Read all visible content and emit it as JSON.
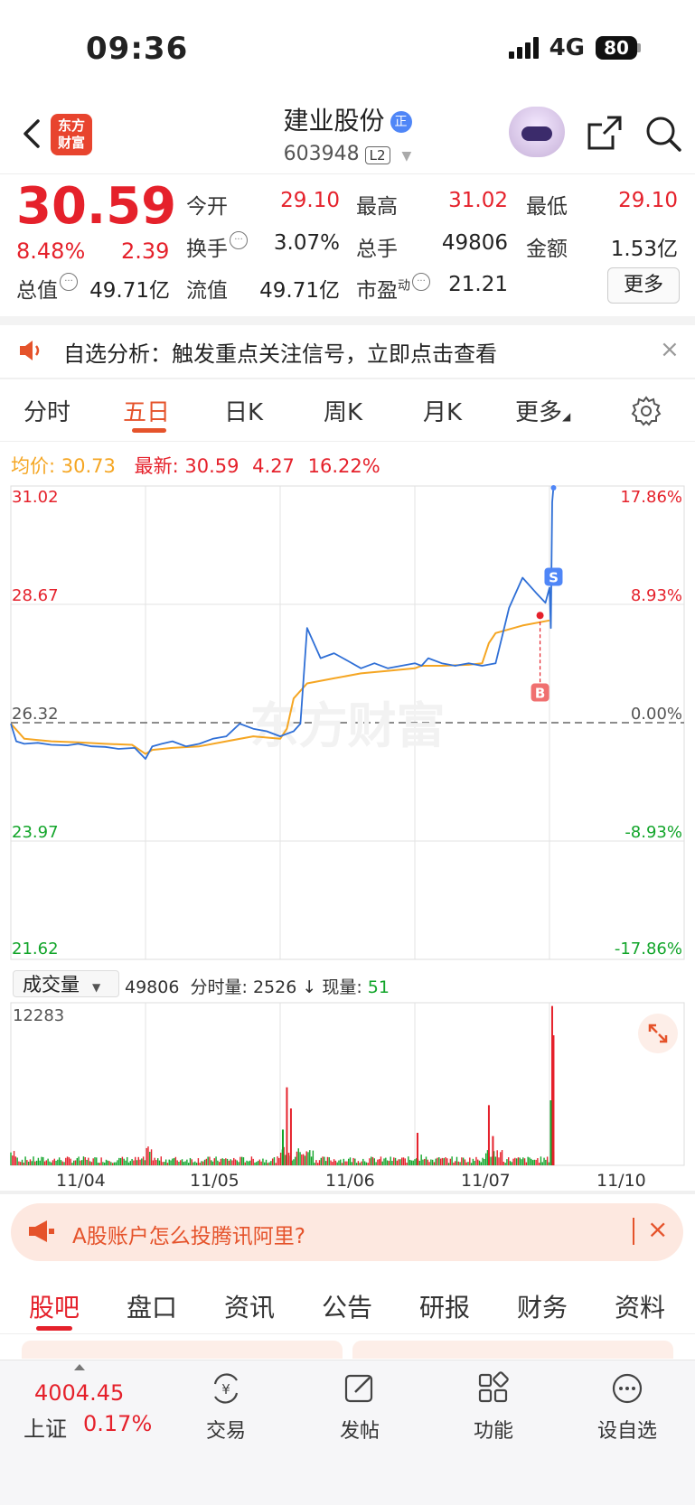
{
  "status_bar": {
    "time": "09:36",
    "network": "4G",
    "battery": "80"
  },
  "header": {
    "logo_line1": "东方",
    "logo_line2": "财富",
    "stock_name": "建业股份",
    "name_badge": "正",
    "stock_code": "603948",
    "level_badge": "L2"
  },
  "quote": {
    "price": "30.59",
    "change_pct": "8.48%",
    "change_amt": "2.39",
    "open_label": "今开",
    "open": "29.10",
    "high_label": "最高",
    "high": "31.02",
    "low_label": "最低",
    "low": "29.10",
    "turnover_label": "换手",
    "turnover": "3.07%",
    "volume_label": "总手",
    "volume": "49806",
    "amount_label": "金额",
    "amount": "1.53亿",
    "mktcap_label": "总值",
    "mktcap": "49.71亿",
    "float_label": "流值",
    "float_cap": "49.71亿",
    "pe_label": "市盈",
    "pe_sup": "动",
    "pe": "21.21",
    "more_label": "更多"
  },
  "notice": {
    "text": "自选分析：触发重点关注信号，立即点击查看",
    "close": "×"
  },
  "chart_tabs": [
    "分时",
    "五日",
    "日K",
    "周K",
    "月K",
    "更多"
  ],
  "active_tab": "五日",
  "legend": {
    "avg_label": "均价:",
    "avg_value": "30.73",
    "latest_label": "最新:",
    "latest_value": "30.59",
    "latest_change": "4.27",
    "latest_pct": "16.22%"
  },
  "chart_data": {
    "type": "line",
    "watermark": "东方财富",
    "y_left_ticks": [
      "31.02",
      "28.67",
      "26.32",
      "23.97",
      "21.62"
    ],
    "y_right_ticks": [
      "17.86%",
      "8.93%",
      "0.00%",
      "-8.93%",
      "-17.86%"
    ],
    "ylim": [
      21.62,
      31.02
    ],
    "base_price": 26.32,
    "x_labels": [
      "11/04",
      "11/05",
      "11/06",
      "11/07",
      "11/10"
    ],
    "markers": [
      {
        "label": "S",
        "color": "#4f86f7"
      },
      {
        "label": "B",
        "color": "#f07070"
      }
    ],
    "series": [
      {
        "name": "最新",
        "color": "#2f6fd6",
        "x": [
          0,
          0.04,
          0.1,
          0.2,
          0.3,
          0.42,
          0.5,
          0.6,
          0.7,
          0.8,
          0.92,
          1.0,
          1.05,
          1.12,
          1.2,
          1.3,
          1.4,
          1.5,
          1.6,
          1.7,
          1.8,
          1.9,
          2.0,
          2.05,
          2.1,
          2.15,
          2.2,
          2.3,
          2.4,
          2.5,
          2.6,
          2.7,
          2.8,
          2.9,
          3.0,
          3.05,
          3.1,
          3.2,
          3.3,
          3.4,
          3.5,
          3.6,
          3.7,
          3.8,
          3.9,
          3.97,
          4.0,
          4.01,
          4.02,
          4.03
        ],
        "values": [
          26.3,
          25.95,
          25.9,
          25.92,
          25.88,
          25.87,
          25.9,
          25.85,
          25.84,
          25.8,
          25.82,
          25.6,
          25.85,
          25.9,
          25.95,
          25.85,
          25.9,
          26.0,
          26.05,
          26.3,
          26.2,
          26.15,
          26.05,
          26.1,
          26.15,
          26.3,
          28.2,
          27.6,
          27.7,
          27.55,
          27.4,
          27.5,
          27.4,
          27.45,
          27.5,
          27.45,
          27.6,
          27.5,
          27.45,
          27.5,
          27.45,
          27.5,
          28.6,
          29.2,
          28.9,
          28.7,
          29.0,
          28.2,
          30.7,
          31.02
        ]
      },
      {
        "name": "均价",
        "color": "#f5a623",
        "x": [
          0,
          0.1,
          0.3,
          0.5,
          0.7,
          0.9,
          1.0,
          1.05,
          1.2,
          1.4,
          1.6,
          1.8,
          2.0,
          2.05,
          2.1,
          2.2,
          2.4,
          2.6,
          2.8,
          3.0,
          3.05,
          3.2,
          3.4,
          3.5,
          3.55,
          3.6,
          3.8,
          4.0
        ],
        "values": [
          26.3,
          26.0,
          25.95,
          25.93,
          25.9,
          25.88,
          25.7,
          25.78,
          25.82,
          25.85,
          25.95,
          26.05,
          26.0,
          26.2,
          26.8,
          27.1,
          27.2,
          27.3,
          27.35,
          27.4,
          27.45,
          27.45,
          27.47,
          27.5,
          27.9,
          28.1,
          28.25,
          28.35
        ]
      }
    ]
  },
  "volume": {
    "selector_label": "成交量",
    "total": "49806",
    "period_label": "分时量:",
    "period_value": "2526",
    "arrow": "↓",
    "current_label": "现量:",
    "current_value": "51",
    "max_tick": "12283"
  },
  "ad": {
    "text": "A股账户怎么投腾讯阿里?",
    "close": "×"
  },
  "bottom_tabs": [
    "股吧",
    "盘口",
    "资讯",
    "公告",
    "研报",
    "财务",
    "资料"
  ],
  "active_bottom_tab": "股吧",
  "bottom_bar": {
    "index_value": "4004.45",
    "index_name": "上证",
    "index_change": "0.17%",
    "nav": [
      {
        "label": "交易",
        "icon": "yen-exchange-icon"
      },
      {
        "label": "发帖",
        "icon": "edit-icon"
      },
      {
        "label": "功能",
        "icon": "grid-icon"
      },
      {
        "label": "设自选",
        "icon": "more-dots-icon"
      }
    ]
  },
  "colors": {
    "up": "#e5212b",
    "down": "#12a52a",
    "accent": "#e5532b",
    "line": "#2f6fd6",
    "avg": "#f5a623"
  }
}
